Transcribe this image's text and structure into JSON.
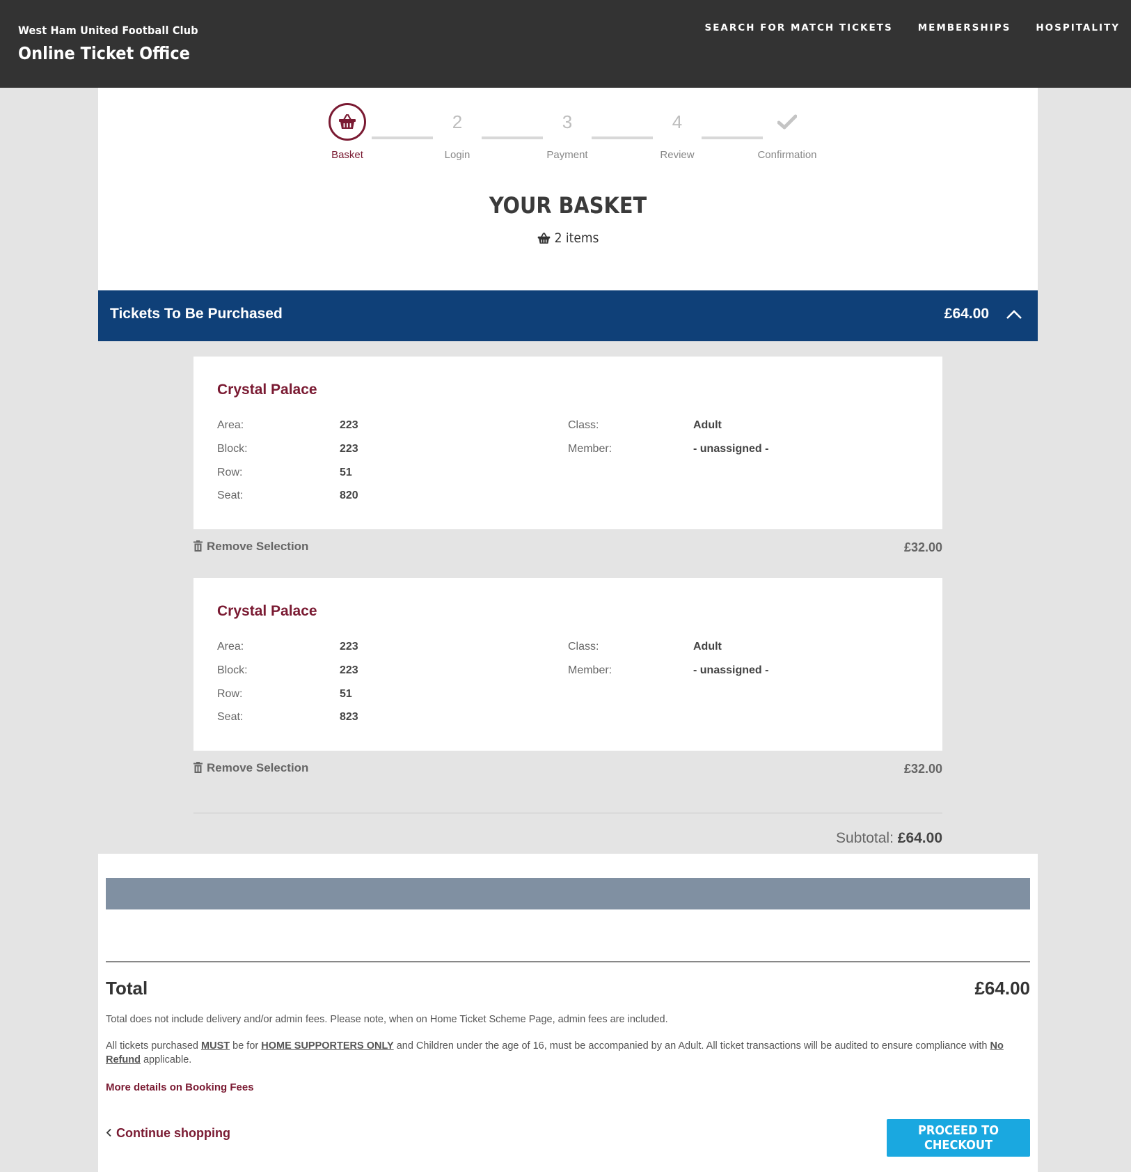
{
  "header": {
    "club_name": "West Ham United Football Club",
    "office_title": "Online Ticket Office",
    "nav": [
      "SEARCH FOR MATCH TICKETS",
      "MEMBERSHIPS",
      "HOSPITALITY"
    ]
  },
  "steps": [
    {
      "label": "Basket",
      "marker": "basket-icon",
      "active": true
    },
    {
      "label": "Login",
      "marker": "2",
      "active": false
    },
    {
      "label": "Payment",
      "marker": "3",
      "active": false
    },
    {
      "label": "Review",
      "marker": "4",
      "active": false
    },
    {
      "label": "Confirmation",
      "marker": "checkmark-icon",
      "active": false
    }
  ],
  "basket": {
    "title": "YOUR BASKET",
    "count": "2 items"
  },
  "section": {
    "title": "Tickets To Be Purchased",
    "amount": "£64.00"
  },
  "tickets": [
    {
      "event": "Crystal Palace",
      "area_label": "Area:",
      "area": "223",
      "block_label": "Block:",
      "block": "223",
      "row_label": "Row:",
      "row": "51",
      "seat_label": "Seat:",
      "seat": "820",
      "class_label": "Class:",
      "class": "Adult",
      "member_label": "Member:",
      "member": "- unassigned -",
      "remove": "Remove Selection",
      "price": "£32.00"
    },
    {
      "event": "Crystal Palace",
      "area_label": "Area:",
      "area": "223",
      "block_label": "Block:",
      "block": "223",
      "row_label": "Row:",
      "row": "51",
      "seat_label": "Seat:",
      "seat": "823",
      "class_label": "Class:",
      "class": "Adult",
      "member_label": "Member:",
      "member": "- unassigned -",
      "remove": "Remove Selection",
      "price": "£32.00"
    }
  ],
  "subtotal": {
    "label": "Subtotal:",
    "value": "£64.00"
  },
  "total": {
    "label": "Total",
    "value": "£64.00"
  },
  "notes": {
    "fees": "Total does not include delivery and/or admin fees. Please note, when on Home Ticket Scheme Page, admin fees are included.",
    "policy_1": "All tickets purchased ",
    "policy_must": "MUST",
    "policy_2": " be for ",
    "policy_home": "HOME SUPPORTERS ONLY",
    "policy_3": " and Children under the age of 16, must be accompanied by an Adult. All ticket transactions will be audited to ensure compliance with ",
    "policy_norefund": "No Refund",
    "policy_4": " applicable."
  },
  "links": {
    "fees_details": "More details on Booking Fees",
    "continue": "Continue shopping",
    "checkout": "PROCEED TO CHECKOUT"
  },
  "colors": {
    "header_bg": "#333333",
    "section_header": "#0f4078",
    "accent_claret": "#7a1a32",
    "checkout_button": "#1aa8e0",
    "grey_bar": "#8090a2"
  }
}
